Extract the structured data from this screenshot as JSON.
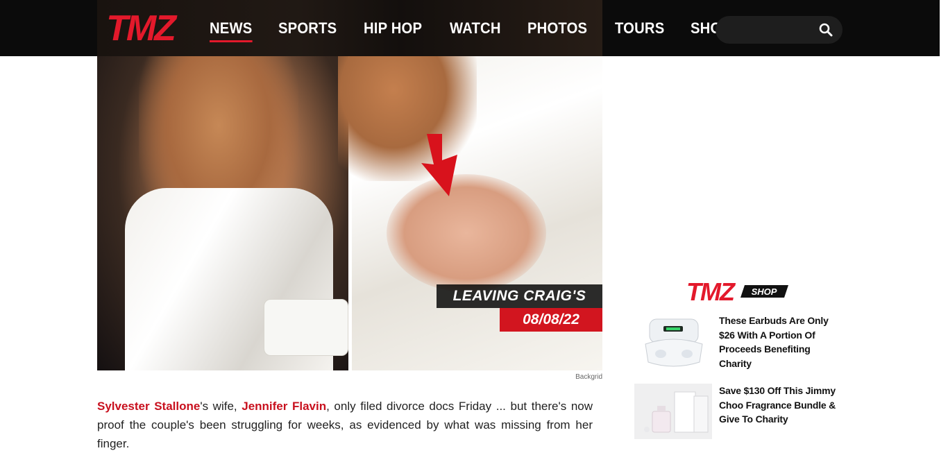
{
  "header": {
    "logo_text": "TMZ",
    "nav": [
      {
        "label": "NEWS",
        "active": true
      },
      {
        "label": "SPORTS",
        "active": false
      },
      {
        "label": "HIP HOP",
        "active": false
      },
      {
        "label": "WATCH",
        "active": false
      },
      {
        "label": "PHOTOS",
        "active": false
      },
      {
        "label": "TOURS",
        "active": false
      },
      {
        "label": "SHOP",
        "active": false
      }
    ],
    "search": {
      "placeholder": "",
      "icon": "search-icon"
    }
  },
  "hero": {
    "tag_text": "LEAVING CRAIG'S",
    "date_text": "08/08/22",
    "credit": "Backgrid"
  },
  "article": {
    "link1": "Sylvester Stallone",
    "text1": "'s wife, ",
    "link2": "Jennifer Flavin",
    "text2": ", only filed divorce docs Friday ... but there's now proof the couple's been struggling for weeks, as evidenced by what was missing from her finger."
  },
  "sidebar": {
    "shop_logo_text": "TMZ",
    "shop_label": "SHOP",
    "products": [
      {
        "title": "These Earbuds Are Only $26 With A Portion Of Proceeds Benefiting Charity"
      },
      {
        "title": "Save $130 Off This Jimmy Choo Fragrance Bundle & Give To Charity"
      }
    ]
  },
  "colors": {
    "brand_red": "#e3192b",
    "nav_bg": "#0b0b0b",
    "link_red": "#c8101e"
  }
}
